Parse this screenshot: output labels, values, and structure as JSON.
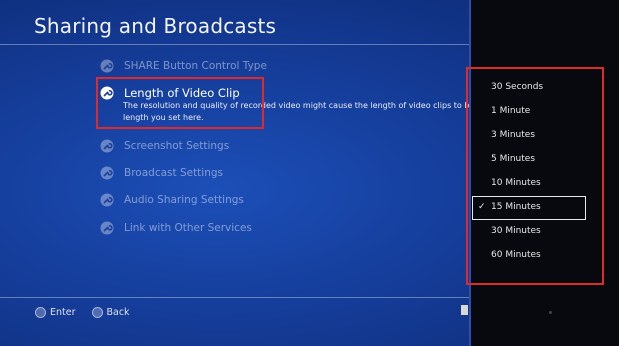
{
  "screen": {
    "title": "Sharing and Broadcasts"
  },
  "menu": {
    "items": [
      {
        "label": "SHARE Button Control Type",
        "icon": "wrench-icon"
      },
      {
        "label": "Length of Video Clip",
        "icon": "wrench-icon"
      },
      {
        "label": "Screenshot Settings",
        "icon": "wrench-icon"
      },
      {
        "label": "Broadcast Settings",
        "icon": "wrench-icon"
      },
      {
        "label": "Audio Sharing Settings",
        "icon": "wrench-icon"
      },
      {
        "label": "Link with Other Services",
        "icon": "wrench-icon"
      }
    ],
    "active_description_line1": "The resolution and quality of recorded video might cause the length of video clips to be s",
    "active_description_line2": "length you set here."
  },
  "options": {
    "items": [
      "30 Seconds",
      "1 Minute",
      "3 Minutes",
      "5 Minutes",
      "10 Minutes",
      "15 Minutes",
      "30 Minutes",
      "60 Minutes"
    ],
    "selected": "15 Minutes",
    "check_glyph": "✓"
  },
  "footer": {
    "enter_label": "Enter",
    "back_label": "Back"
  },
  "colors": {
    "background": "#153d9a",
    "highlight": "#e02a2a",
    "panel": "#07090f"
  }
}
